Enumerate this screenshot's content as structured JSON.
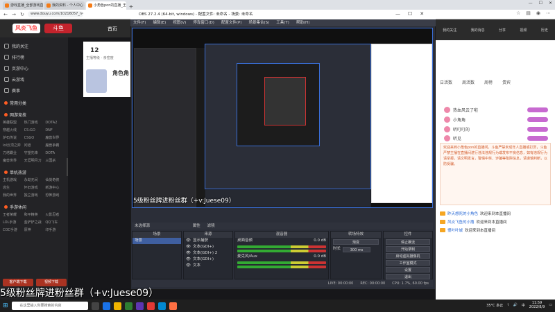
{
  "browser": {
    "tabs": [
      {
        "label": "游戏直播_全部游戏直播_斗鱼直播"
      },
      {
        "label": "我的资料 - 个人中心 - 斗鱼"
      },
      {
        "label": "小角色pon的直播_王者荣耀直播_斗鱼"
      }
    ],
    "new_tab": "+",
    "url": "www.douyu.com/10216057_n=5.55598"
  },
  "douyu": {
    "logo": "风炎飞鱼",
    "logo2": "斗鱼",
    "home": "首页",
    "sidebar": {
      "items": [
        "我的关注",
        "排行榜",
        "页游中心",
        "云游戏",
        "赛事"
      ],
      "sections": [
        {
          "title": "常用分类",
          "games": []
        },
        {
          "title": "网游竞技",
          "games": [
            "英雄联盟",
            "热门游戏",
            "DOTA2",
            "穿越火线",
            "CS:GO",
            "DNF",
            "炉石传说",
            "CSGO",
            "魔兽世界",
            "lol云顶之弈",
            "问道",
            "魔兽争霸",
            "刀塔霸业",
            "守望先锋",
            "DOTA",
            "魔兽世界",
            "天涯明月刀",
            "三国杀"
          ]
        },
        {
          "title": "单机热游",
          "games": [
            "主机游戏",
            "永劫无间",
            "仙剑奇侠",
            "逃生",
            "怀旧游戏",
            "新游中心",
            "我的世界",
            "独立游戏",
            "恐怖游戏"
          ]
        },
        {
          "title": "手游休闲",
          "games": [
            "王者荣耀",
            "和平精英",
            "火影忍者",
            "LOL手游",
            "金铲铲之战",
            "QQ飞车",
            "COC手游",
            "原神",
            "印手游"
          ]
        }
      ],
      "footer_buttons": [
        "客户端下载",
        "视频下载"
      ]
    },
    "level_num": "12",
    "level_label": "主播等级 · 亲密度",
    "role_title": "角色角"
  },
  "right_panel": {
    "nav": [
      "我的关注",
      "我的消息",
      "分享",
      "视频",
      "历史"
    ],
    "tabs": [
      "日活数",
      "周活数",
      "周榜",
      "贵宾"
    ],
    "ranks": [
      "热血风云了啦",
      "小角角",
      "听叮叮的",
      "听见"
    ],
    "notice": "欢迎来到小角色pon的直播间，斗鱼严禁未成年人直播或打赏，斗鱼严禁主播在直播间进行违法违规行为或发布不良信息，如有违规行为请举报，请文明发言，警惕中奖、诈骗等陷阱信息，请谨慎判断，以防受骗。",
    "chats": [
      {
        "user": "昨天想死的小角色",
        "text": "欢迎来到本直播间"
      },
      {
        "user": "风炎飞鱼的小撸",
        "text": "欢迎来到本直播间"
      },
      {
        "user": "慢叶叶城",
        "text": "欢迎来到本直播间"
      }
    ]
  },
  "obs": {
    "title": "OBS 27.2.4 (64-bit, windows) - 配置文件: 未命名 - 场景: 未命名",
    "menu": [
      "文件(F)",
      "编辑(E)",
      "视图(V)",
      "停靠窗口(D)",
      "配置文件(P)",
      "场景集合(S)",
      "工具(T)",
      "帮助(H)"
    ],
    "inner_caption": "5级粉丝牌进粉丝群（+v:Juese09）",
    "scene_header": "未选择源",
    "scene_props": [
      "属性",
      "滤镜"
    ],
    "docks": {
      "scenes": {
        "title": "场景",
        "items": [
          "场景"
        ]
      },
      "sources": {
        "title": "来源",
        "items": [
          "显示捕获",
          "文本(GDI+)",
          "文本(GDI+) 2",
          "文本(GDI+)",
          "文本"
        ]
      },
      "mixer": {
        "title": "混音器",
        "items": [
          "桌面音频",
          "麦克风/Aux"
        ],
        "levels": [
          "0.0 dB",
          "0.0 dB"
        ]
      },
      "transitions": {
        "title": "转场特效",
        "fade": "渐变",
        "duration_label": "时长",
        "duration": "300 ms"
      },
      "controls": {
        "title": "控件",
        "buttons": [
          "停止推流",
          "开始录制",
          "启动虚拟摄像机",
          "工作室模式",
          "设置",
          "退出"
        ]
      }
    },
    "status": {
      "live": "LIVE: 00:00:00",
      "rec": "REC: 00:00:00",
      "cpu": "CPU: 1.7%, 60.00 fps"
    }
  },
  "outer_caption": "5级粉丝牌进粉丝群（+v:Juese09）",
  "taskbar": {
    "search_placeholder": "在这里输入你要搜索的内容",
    "weather": "35°C 多云",
    "time": "11:59",
    "date": "2022/8/9",
    "lang": "中"
  }
}
